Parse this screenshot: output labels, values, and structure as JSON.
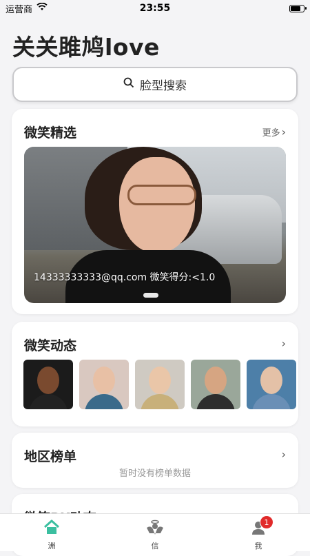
{
  "status_bar": {
    "carrier": "运营商",
    "time": "23:55",
    "battery_level": 0.85
  },
  "page_title": "关关雎鸠love",
  "search": {
    "label": "脸型搜索"
  },
  "sections": {
    "smile_select": {
      "title": "微笑精选",
      "more": "更多",
      "caption": "14333333333@qq.com 微笑得分:<1.0"
    },
    "smile_feed": {
      "title": "微笑动态",
      "avatars": [
        {
          "bg": "#1b1b1b",
          "skin": "#7a4a2f",
          "cloth": "#222"
        },
        {
          "bg": "#d9c8c0",
          "skin": "#e8c0a5",
          "cloth": "#3a6a8a"
        },
        {
          "bg": "#cfcac2",
          "skin": "#eac6a8",
          "cloth": "#c8b07a"
        },
        {
          "bg": "#9aa79a",
          "skin": "#d6a582",
          "cloth": "#2d2d2d"
        },
        {
          "bg": "#4d7fa8",
          "skin": "#e4c1a7",
          "cloth": "#6a8fb6"
        }
      ]
    },
    "region_rank": {
      "title": "地区榜单",
      "empty": "暂时没有榜单数据"
    },
    "smile_pk": {
      "title": "微笑PK动态"
    }
  },
  "tabs": [
    {
      "label": "洲",
      "icon": "home-icon",
      "color": "#3bbfa0"
    },
    {
      "label": "信",
      "icon": "angel-icon",
      "color": "#777"
    },
    {
      "label": "我",
      "icon": "person-icon",
      "color": "#777",
      "badge": "1"
    }
  ]
}
